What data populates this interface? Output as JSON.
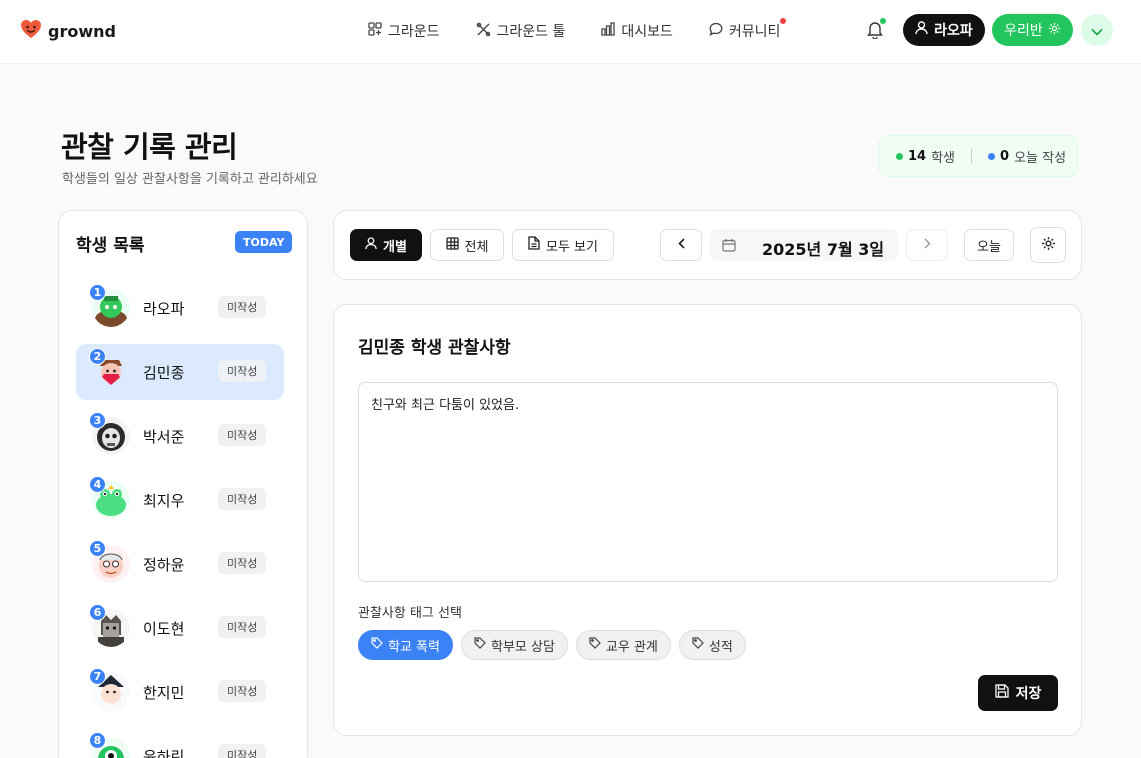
{
  "app": {
    "name": "grownd"
  },
  "nav": {
    "items": [
      {
        "label": "그라운드",
        "icon": "grid-plus-icon"
      },
      {
        "label": "그라운드 툴",
        "icon": "tools-icon"
      },
      {
        "label": "대시보드",
        "icon": "bar-chart-icon"
      },
      {
        "label": "커뮤니티",
        "icon": "chat-bubble-icon",
        "has_notification": true
      }
    ]
  },
  "header_actions": {
    "user_name": "라오파",
    "class_label": "우리반",
    "bell_has_notification": true
  },
  "page": {
    "title": "관찰 기록 관리",
    "subtitle": "학생들의 일상 관찰사항을 기록하고 관리하세요"
  },
  "stats": {
    "students_count": "14",
    "students_label": "학생",
    "today_count": "0",
    "today_label": "오늘 작성",
    "students_color": "#22c55e",
    "today_color": "#3b82f6"
  },
  "student_list": {
    "title": "학생 목록",
    "badge": "TODAY",
    "students": [
      {
        "num": "1",
        "name": "라오파",
        "status": "미작성",
        "selected": false
      },
      {
        "num": "2",
        "name": "김민종",
        "status": "미작성",
        "selected": true
      },
      {
        "num": "3",
        "name": "박서준",
        "status": "미작성",
        "selected": false
      },
      {
        "num": "4",
        "name": "최지우",
        "status": "미작성",
        "selected": false
      },
      {
        "num": "5",
        "name": "정하윤",
        "status": "미작성",
        "selected": false
      },
      {
        "num": "6",
        "name": "이도현",
        "status": "미작성",
        "selected": false
      },
      {
        "num": "7",
        "name": "한지민",
        "status": "미작성",
        "selected": false
      },
      {
        "num": "8",
        "name": "윤하린",
        "status": "미작성",
        "selected": false
      }
    ]
  },
  "toolbar": {
    "individual": "개별",
    "all": "전체",
    "view_all": "모두 보기",
    "date": "2025년 7월 3일",
    "today": "오늘"
  },
  "observation": {
    "title": "김민종 학생 관찰사항",
    "text": "친구와 최근 다툼이 있었음.",
    "tags_label": "관찰사항 태그 선택",
    "tags": [
      {
        "label": "학교 폭력",
        "active": true
      },
      {
        "label": "학부모 상담",
        "active": false
      },
      {
        "label": "교우 관계",
        "active": false
      },
      {
        "label": "성적",
        "active": false
      }
    ],
    "save": "저장"
  },
  "colors": {
    "accent_blue": "#3b82f6",
    "accent_green": "#22c55e",
    "dark": "#111111",
    "logo": "#ef5a3c"
  }
}
